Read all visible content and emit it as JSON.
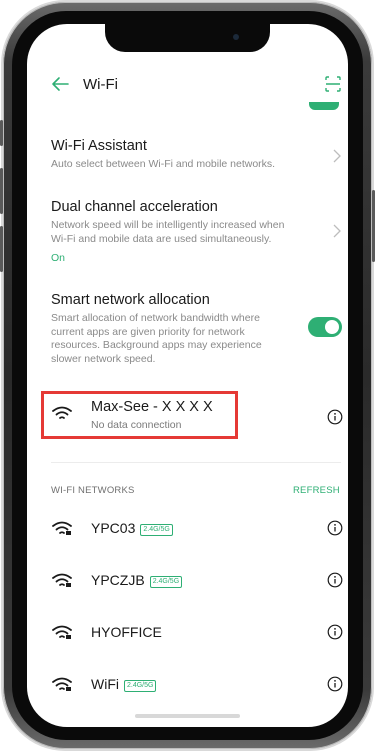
{
  "header": {
    "title": "Wi-Fi",
    "back_icon": "arrow-left-icon",
    "scan_icon": "qr-scan-icon"
  },
  "colors": {
    "accent": "#2eaf74",
    "highlight_box": "#e53935"
  },
  "settings": {
    "wifi_assistant": {
      "title": "Wi-Fi Assistant",
      "description": "Auto select between Wi-Fi and mobile networks."
    },
    "dual_channel": {
      "title": "Dual channel acceleration",
      "description_line1": "Network speed will be intelligently increased when",
      "description_line2": "Wi-Fi and mobile data are used simultaneously.",
      "status": "On"
    },
    "smart_allocation": {
      "title": "Smart network allocation",
      "description_line1": "Smart allocation of network bandwidth where",
      "description_line2": "current apps are given priority for network",
      "description_line3": "resources. Background apps may experience",
      "description_line4": "slower network speed.",
      "enabled": true
    }
  },
  "connected": {
    "name": "Max-See - X X X X",
    "status": "No data connection"
  },
  "networks_section": {
    "label": "WI-FI NETWORKS",
    "refresh_label": "REFRESH",
    "items": [
      {
        "name": "YPC03",
        "badge": "2.4G/5G"
      },
      {
        "name": "YPCZJB",
        "badge": "2.4G/5G"
      },
      {
        "name": "HYOFFICE",
        "badge": ""
      },
      {
        "name": "WiFi",
        "badge": "2.4G/5G"
      }
    ]
  }
}
